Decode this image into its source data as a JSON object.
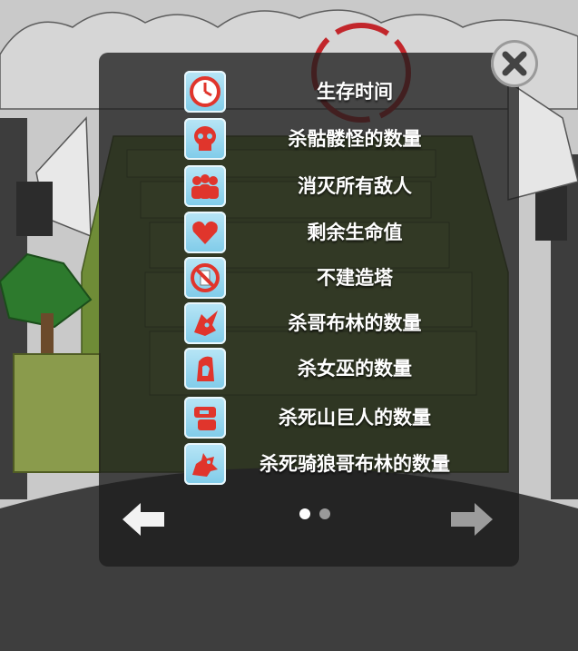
{
  "colors": {
    "panel": "#1e1e1e",
    "icon_tile": "#8fd3ee",
    "icon_glyph": "#e0352c",
    "text": "#ffffff",
    "grass": "#7a9a3a",
    "dot_active": "#ffffff",
    "dot_inactive": "#9a9a9a"
  },
  "criteria": [
    {
      "label": "生存时间",
      "icon": "clock-icon"
    },
    {
      "label": "杀骷髅怪的数量",
      "icon": "skull-icon"
    },
    {
      "label": "消灭所有敌人",
      "icon": "group-icon"
    },
    {
      "label": "剩余生命值",
      "icon": "heart-icon"
    },
    {
      "label": "不建造塔",
      "icon": "no-tower-icon"
    },
    {
      "label": "杀哥布林的数量",
      "icon": "goblin-icon"
    },
    {
      "label": "杀女巫的数量",
      "icon": "witch-icon"
    },
    {
      "label": "杀死山巨人的数量",
      "icon": "giant-icon"
    },
    {
      "label": "杀死骑狼哥布林的数量",
      "icon": "wolf-rider-icon"
    }
  ],
  "pagination": {
    "current_page": 1,
    "total_pages": 2
  },
  "controls": {
    "close_icon": "close-icon",
    "prev_icon": "arrow-left-icon",
    "next_icon": "arrow-right-icon"
  }
}
